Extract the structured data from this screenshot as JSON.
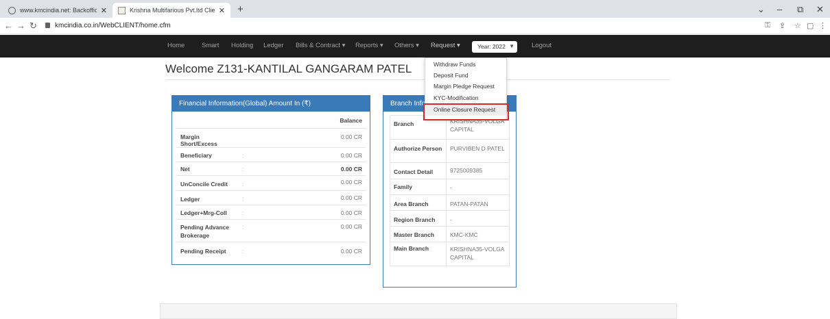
{
  "browser": {
    "tabs": [
      {
        "title": "www.kmcindia.net: Backoffice",
        "close": "✕"
      },
      {
        "title": "Krishna Multifarious Pvt.ltd Client",
        "close": "✕"
      }
    ],
    "new_tab": "+",
    "url": "kmcindia.co.in/WebCLIENT/home.cfm",
    "window_controls": [
      "⌄",
      "–",
      "⧉",
      "✕"
    ]
  },
  "nav": {
    "items": [
      "Home",
      "Smart",
      "Holding",
      "Ledger",
      "Bills & Contract ▾",
      "Reports ▾",
      "Others ▾",
      "Request ▾"
    ],
    "year": "Year: 2022",
    "logout": "Logout"
  },
  "welcome": "Welcome Z131-KANTILAL GANGARAM PATEL",
  "financial": {
    "title": "Financial Information(Global) Amount In (₹)",
    "header_balance": "Balance",
    "rows": [
      {
        "label": "Margin Short/Excess",
        "sep": "",
        "value": "0.00 CR"
      },
      {
        "label": "Beneficiary",
        "sep": ":",
        "value": "0.00 CR"
      },
      {
        "label": "Net",
        "sep": ":",
        "value": "0.00 CR"
      },
      {
        "label": "UnConcile Credit",
        "sep": ":",
        "value": "0.00 CR"
      },
      {
        "label": "Ledger",
        "sep": ":",
        "value": "0.00 CR"
      },
      {
        "label": "Ledger+Mrg-Coll",
        "sep": ":",
        "value": "0.00 CR"
      },
      {
        "label": "Pending Advance Brokerage",
        "sep": ":",
        "value": "0.00 CR"
      },
      {
        "label": "Pending Receipt",
        "sep": ":",
        "value": "0.00 CR"
      }
    ]
  },
  "branch": {
    "title": "Branch Info",
    "rows": [
      {
        "label": "Branch",
        "value": "KRISHNA35-VOLGA CAPITAL"
      },
      {
        "label": "Authorize Person",
        "value": "PURVIBEN D PATEL"
      },
      {
        "label": "Contact Detail",
        "value": "9725009385"
      },
      {
        "label": "Family",
        "value": "-"
      },
      {
        "label": "Area Branch",
        "value": "PATAN-PATAN"
      },
      {
        "label": "Region Branch",
        "value": "-"
      },
      {
        "label": "Master Branch",
        "value": "KMC-KMC"
      },
      {
        "label": "Main Branch",
        "value": "KRISHNA35-VOLGA CAPITAL"
      }
    ]
  },
  "request_menu": {
    "items": [
      "Withdraw Funds",
      "Deposit Fund",
      "Margin Pledge Request",
      "KYC-Modification",
      "Online Closure Request"
    ]
  },
  "colors": {
    "accent": "#3b7ab8",
    "navbar": "#1e1e1e",
    "highlight": "#d22c2c"
  }
}
